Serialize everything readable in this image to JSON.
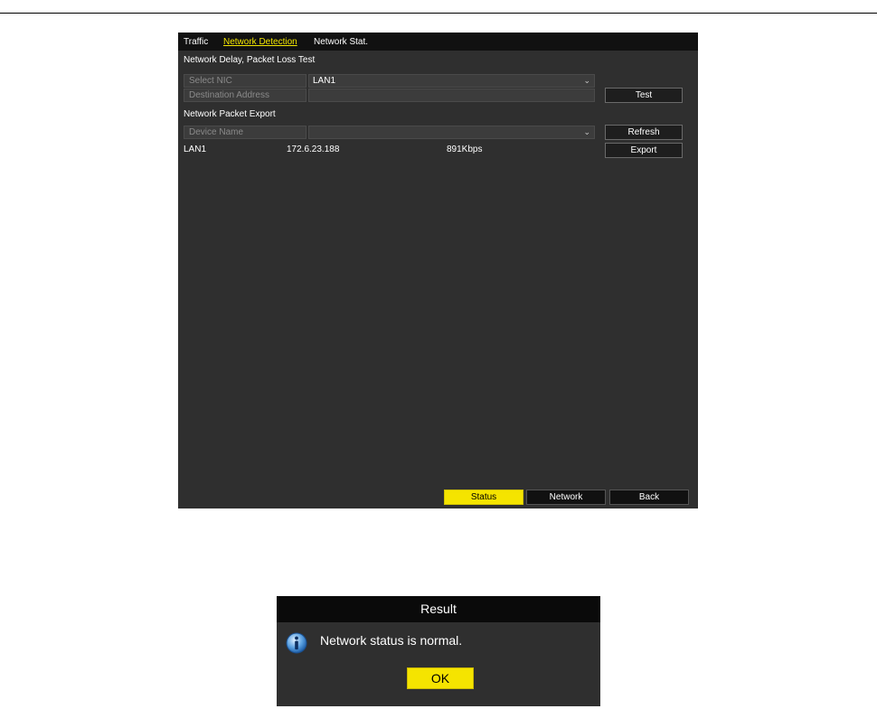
{
  "tabs": [
    {
      "label": "Traffic",
      "active": false
    },
    {
      "label": "Network Detection",
      "active": true
    },
    {
      "label": "Network Stat.",
      "active": false
    }
  ],
  "delay_section": {
    "title": "Network Delay, Packet Loss Test",
    "select_nic_label": "Select NIC",
    "select_nic_value": "LAN1",
    "destination_label": "Destination Address",
    "destination_value": "",
    "test_button": "Test"
  },
  "export_section": {
    "title": "Network Packet Export",
    "device_name_label": "Device Name",
    "device_name_value": "",
    "refresh_button": "Refresh",
    "export_button": "Export",
    "nic": {
      "name": "LAN1",
      "ip": "172.6.23.188",
      "rate": "891Kbps"
    }
  },
  "bottom_buttons": {
    "status": "Status",
    "network": "Network",
    "back": "Back"
  },
  "dialog": {
    "title": "Result",
    "message": "Network status is normal.",
    "ok_button": "OK"
  },
  "colors": {
    "accent": "#f5e400",
    "panel": "#2f2f2f",
    "tabbar": "#111111"
  }
}
